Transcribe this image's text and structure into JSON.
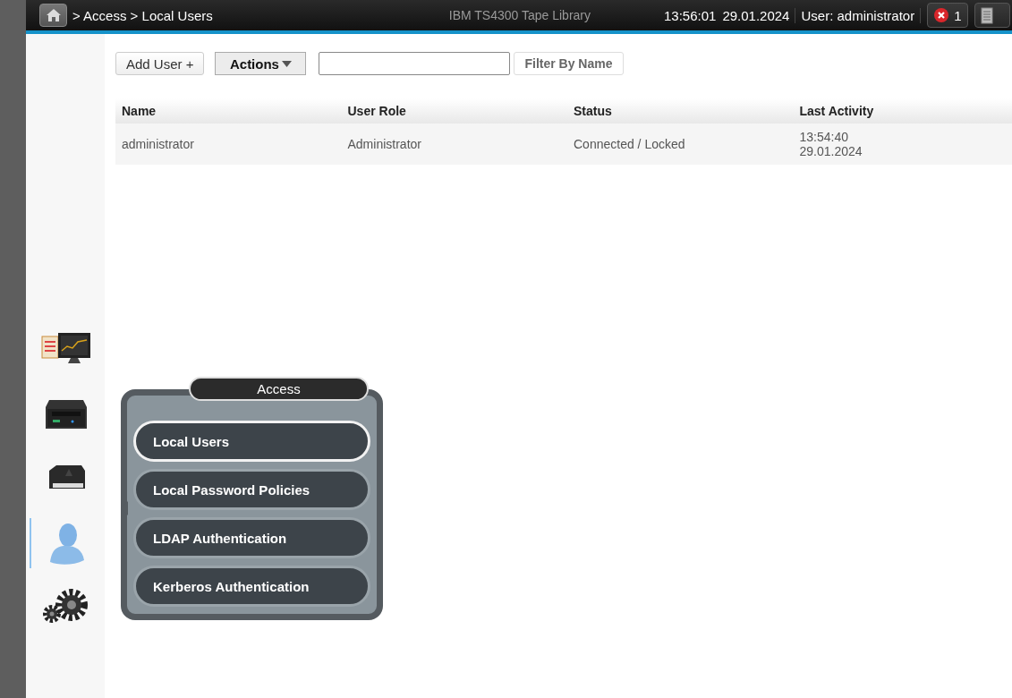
{
  "top_bar": {
    "breadcrumb": "> Access > Local Users",
    "product": "IBM TS4300 Tape Library",
    "time": "13:56:01",
    "date": "29.01.2024",
    "user": "User: administrator",
    "error_count": "1"
  },
  "sidebar": {
    "items": [
      {
        "kind": "monitoring",
        "selected": false
      },
      {
        "kind": "drive",
        "selected": false
      },
      {
        "kind": "cartridge",
        "selected": false
      },
      {
        "kind": "user",
        "selected": true
      },
      {
        "kind": "settings",
        "selected": false
      }
    ]
  },
  "toolbar": {
    "add_button": "Add User +",
    "actions_button": "Actions",
    "filter_button": "Filter By Name"
  },
  "table": {
    "columns": [
      "Name",
      "User Role",
      "Status",
      "Last Activity"
    ],
    "rows": [
      {
        "name": "administrator",
        "role": "Administrator",
        "status": "Connected / Locked",
        "last_activity": [
          "13:54:40",
          "29.01.2024"
        ]
      }
    ]
  },
  "flyout": {
    "title": "Access",
    "items": [
      {
        "label": "Local Users",
        "selected": true
      },
      {
        "label": "Local Password Policies",
        "selected": false
      },
      {
        "label": "LDAP Authentication",
        "selected": false
      },
      {
        "label": "Kerberos Authentication",
        "selected": false
      }
    ]
  }
}
